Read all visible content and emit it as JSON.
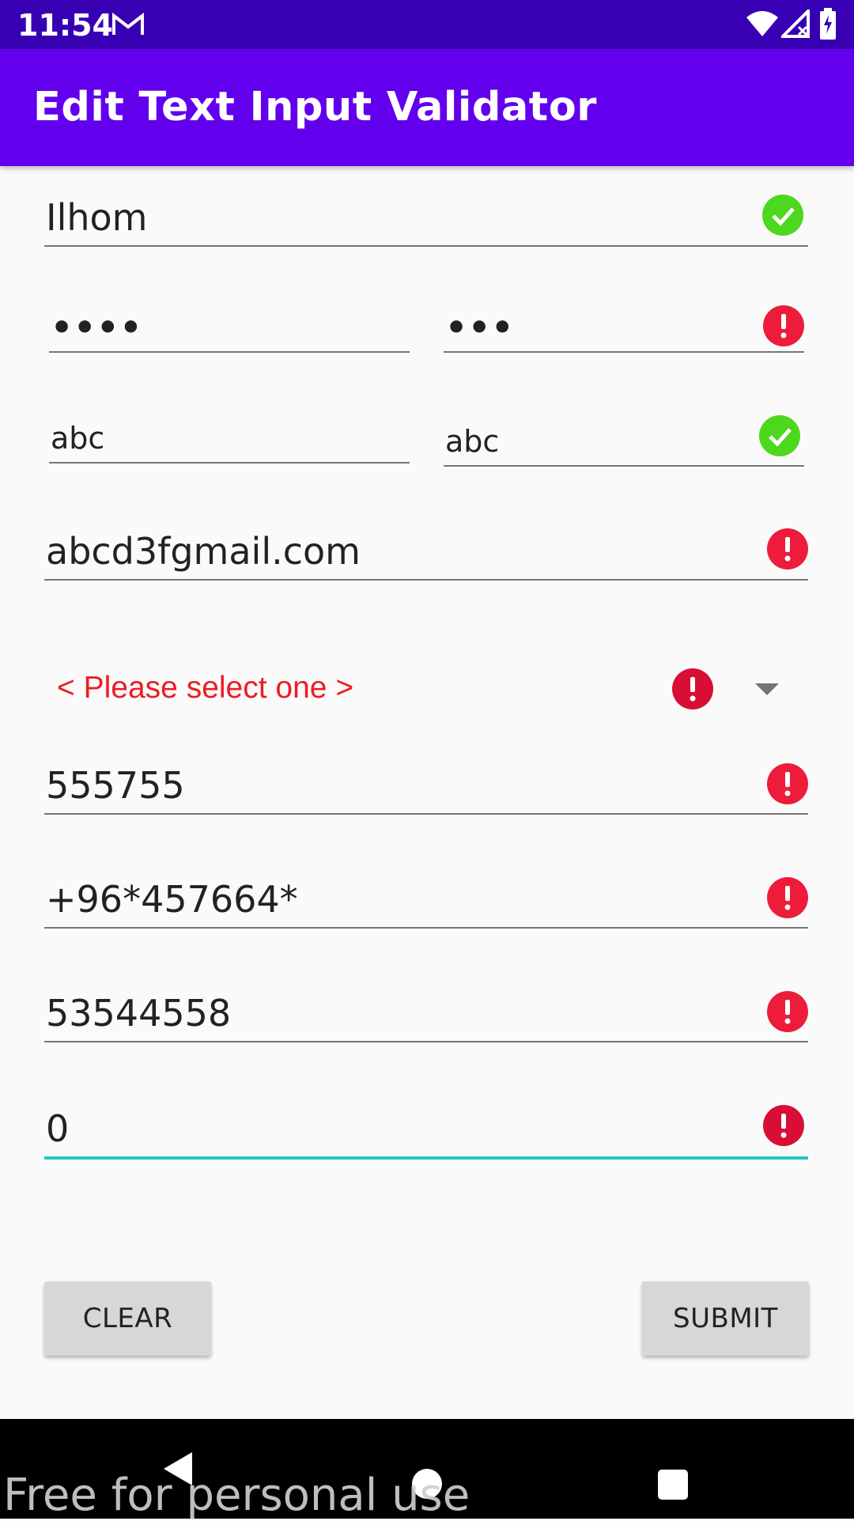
{
  "status_bar": {
    "time": "11:54",
    "icons": [
      "gmail-icon",
      "wifi-icon",
      "signal-icon",
      "battery-charging-icon"
    ]
  },
  "app_bar": {
    "title": "Edit Text Input Validator"
  },
  "form": {
    "name": {
      "value": "Ilhom",
      "state": "valid"
    },
    "password": {
      "value": "••••"
    },
    "confirm_password": {
      "value": "•••",
      "state": "error"
    },
    "text_left": {
      "value": "abc"
    },
    "text_right": {
      "value": "abc",
      "state": "valid"
    },
    "email": {
      "value": "abcd3fgmail.com",
      "state": "error"
    },
    "spinner": {
      "selected": "< Please select one >",
      "state": "error"
    },
    "number": {
      "value": "555755",
      "state": "error"
    },
    "phone": {
      "value": "+96*457664*",
      "state": "error"
    },
    "digits": {
      "value": "53544558",
      "state": "error"
    },
    "amount": {
      "value": "0",
      "state": "error",
      "focused": true
    }
  },
  "buttons": {
    "clear": "CLEAR",
    "submit": "SUBMIT"
  },
  "watermark": "Free for personal use",
  "colors": {
    "status_bar": "#3700b3",
    "app_bar": "#6200ee",
    "valid": "#4cd81c",
    "error": "#ec1c3a",
    "spinner_text": "#ec1c24",
    "focus_underline": "#26c6c6"
  }
}
